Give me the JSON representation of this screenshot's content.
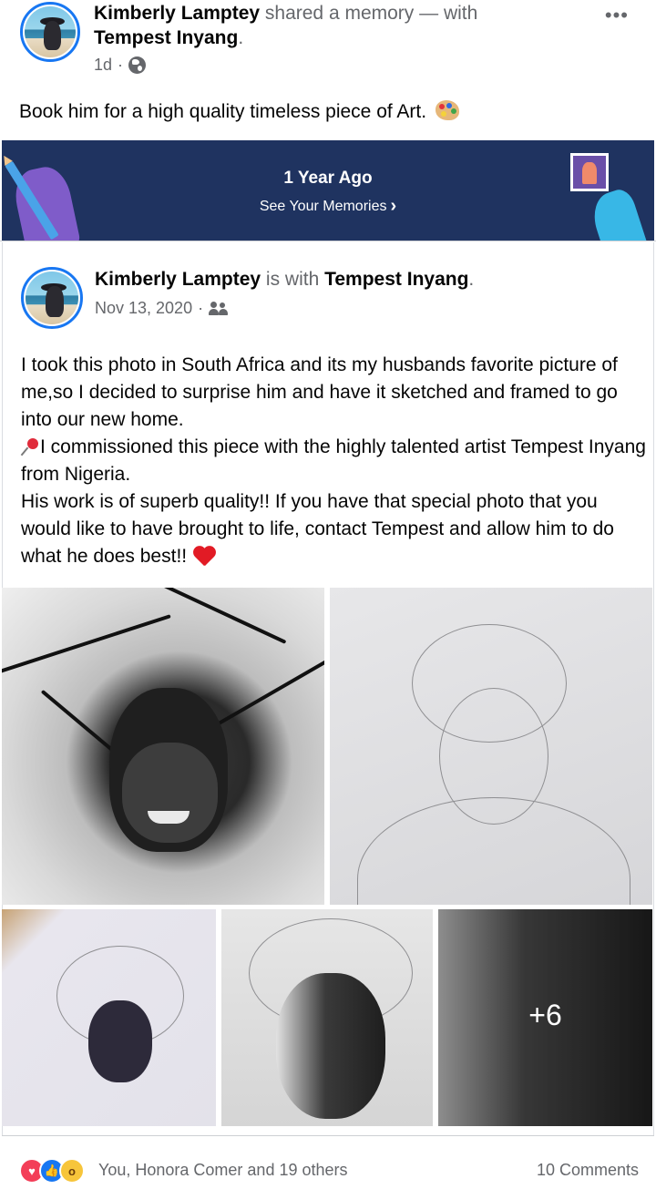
{
  "shared_post": {
    "author": "Kimberly Lamptey",
    "action": "shared a memory — with",
    "tagged": "Tempest Inyang",
    "period": ".",
    "time": "1d",
    "separator": "·",
    "privacy_icon": "globe-icon",
    "more_icon": "•••",
    "caption": "Book him for a high quality timeless piece of Art."
  },
  "memory_banner": {
    "title": "1 Year Ago",
    "link": "See Your Memories",
    "chevron": "›",
    "background": "#1f3360"
  },
  "original_post": {
    "author": "Kimberly Lamptey",
    "action": "is with",
    "tagged": "Tempest Inyang",
    "period": ".",
    "date": "Nov 13, 2020",
    "separator": "·",
    "audience_icon": "friends-icon",
    "body": {
      "p1": "I took this photo in South Africa and its my husbands favorite picture of me,so I decided to surprise him and have it sketched and framed to go into our new home.",
      "p2": "I commissioned this piece with the highly talented artist Tempest Inyang from Nigeria.",
      "p3": "His work is of superb quality!! If you have that special photo that you would like to have brought to life, contact Tempest and allow him to do what he does best!!"
    },
    "photos": {
      "more_count": "+6"
    }
  },
  "reactions": {
    "types": [
      "love",
      "like",
      "wow"
    ],
    "summary": "You, Honora Comer and 19 others",
    "comments": "10 Comments"
  },
  "colors": {
    "accent": "#1877f2",
    "muted_text": "#65676b",
    "love": "#f33e58",
    "wow": "#f7c53b"
  }
}
